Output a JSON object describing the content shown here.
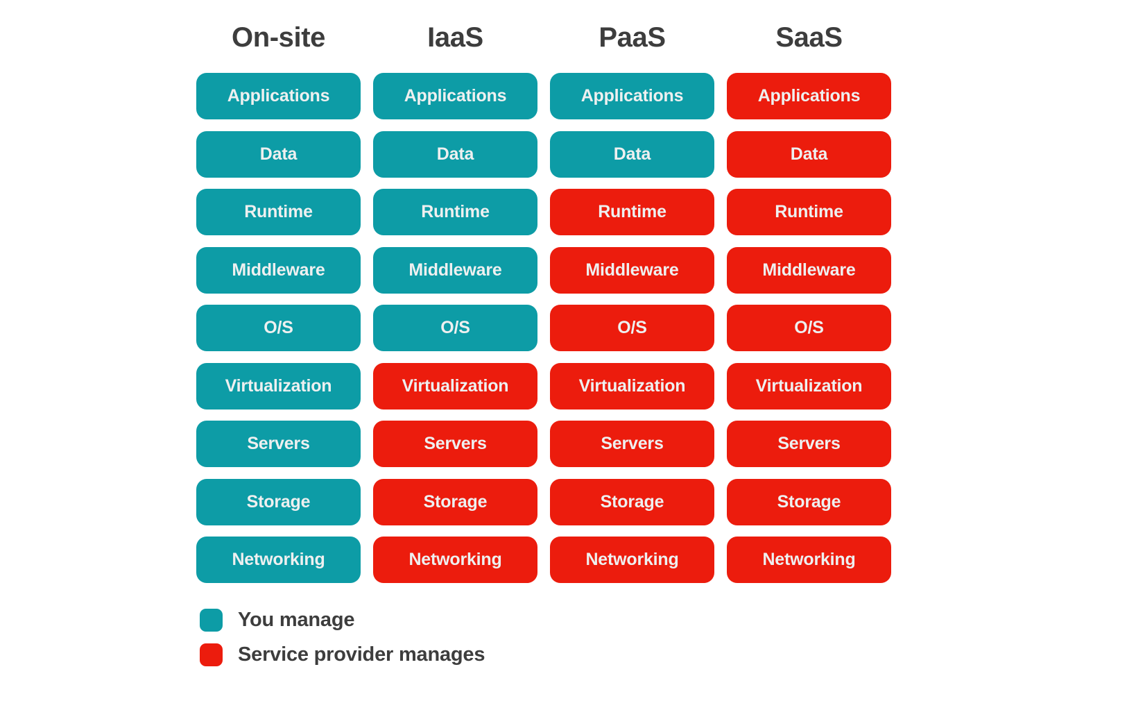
{
  "colors": {
    "manage_self": "#0d9ca6",
    "manage_provider": "#ec1c0d",
    "cell_text": "#eef0f0",
    "heading_text": "#3d3d3d",
    "background": "#ffffff"
  },
  "chart_data": {
    "type": "table",
    "title": "",
    "legend_position": "bottom-left",
    "categories": [
      "On-site",
      "IaaS",
      "PaaS",
      "SaaS"
    ],
    "rows": [
      "Applications",
      "Data",
      "Runtime",
      "Middleware",
      "O/S",
      "Virtualization",
      "Servers",
      "Storage",
      "Networking"
    ],
    "series": [
      {
        "name": "On-site",
        "values": [
          "self",
          "self",
          "self",
          "self",
          "self",
          "self",
          "self",
          "self",
          "self"
        ]
      },
      {
        "name": "IaaS",
        "values": [
          "self",
          "self",
          "self",
          "self",
          "self",
          "provider",
          "provider",
          "provider",
          "provider"
        ]
      },
      {
        "name": "PaaS",
        "values": [
          "self",
          "self",
          "provider",
          "provider",
          "provider",
          "provider",
          "provider",
          "provider",
          "provider"
        ]
      },
      {
        "name": "SaaS",
        "values": [
          "provider",
          "provider",
          "provider",
          "provider",
          "provider",
          "provider",
          "provider",
          "provider",
          "provider"
        ]
      }
    ],
    "legend": [
      {
        "key": "self",
        "label": "You manage",
        "color": "#0d9ca6"
      },
      {
        "key": "provider",
        "label": "Service provider manages",
        "color": "#ec1c0d"
      }
    ]
  },
  "matrix": {
    "headers": [
      {
        "label": "On-site"
      },
      {
        "label": "IaaS"
      },
      {
        "label": "PaaS"
      },
      {
        "label": "SaaS"
      }
    ],
    "cells": [
      {
        "label": "Applications",
        "owner": "self"
      },
      {
        "label": "Applications",
        "owner": "self"
      },
      {
        "label": "Applications",
        "owner": "self"
      },
      {
        "label": "Applications",
        "owner": "provider"
      },
      {
        "label": "Data",
        "owner": "self"
      },
      {
        "label": "Data",
        "owner": "self"
      },
      {
        "label": "Data",
        "owner": "self"
      },
      {
        "label": "Data",
        "owner": "provider"
      },
      {
        "label": "Runtime",
        "owner": "self"
      },
      {
        "label": "Runtime",
        "owner": "self"
      },
      {
        "label": "Runtime",
        "owner": "provider"
      },
      {
        "label": "Runtime",
        "owner": "provider"
      },
      {
        "label": "Middleware",
        "owner": "self"
      },
      {
        "label": "Middleware",
        "owner": "self"
      },
      {
        "label": "Middleware",
        "owner": "provider"
      },
      {
        "label": "Middleware",
        "owner": "provider"
      },
      {
        "label": "O/S",
        "owner": "self"
      },
      {
        "label": "O/S",
        "owner": "self"
      },
      {
        "label": "O/S",
        "owner": "provider"
      },
      {
        "label": "O/S",
        "owner": "provider"
      },
      {
        "label": "Virtualization",
        "owner": "self"
      },
      {
        "label": "Virtualization",
        "owner": "provider"
      },
      {
        "label": "Virtualization",
        "owner": "provider"
      },
      {
        "label": "Virtualization",
        "owner": "provider"
      },
      {
        "label": "Servers",
        "owner": "self"
      },
      {
        "label": "Servers",
        "owner": "provider"
      },
      {
        "label": "Servers",
        "owner": "provider"
      },
      {
        "label": "Servers",
        "owner": "provider"
      },
      {
        "label": "Storage",
        "owner": "self"
      },
      {
        "label": "Storage",
        "owner": "provider"
      },
      {
        "label": "Storage",
        "owner": "provider"
      },
      {
        "label": "Storage",
        "owner": "provider"
      },
      {
        "label": "Networking",
        "owner": "self"
      },
      {
        "label": "Networking",
        "owner": "provider"
      },
      {
        "label": "Networking",
        "owner": "provider"
      },
      {
        "label": "Networking",
        "owner": "provider"
      }
    ]
  },
  "legend": {
    "items": [
      {
        "label": "You manage",
        "owner": "self"
      },
      {
        "label": "Service provider manages",
        "owner": "provider"
      }
    ]
  }
}
